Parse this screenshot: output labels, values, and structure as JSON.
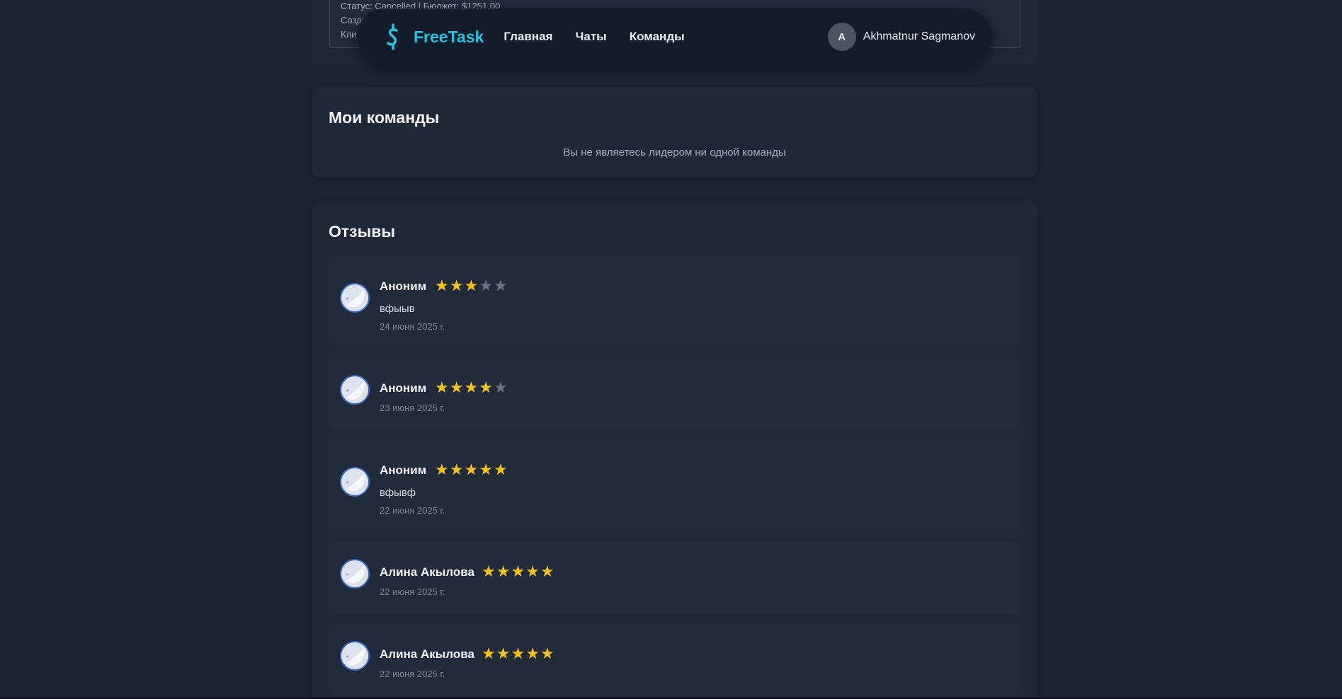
{
  "top_order": {
    "status_line": "Статус: Cancelled | Бюджет: $1251.00",
    "created_label": "Созда",
    "client_label": "Кли"
  },
  "navbar": {
    "logo_text": "FreeTask",
    "links": [
      "Главная",
      "Чаты",
      "Команды"
    ],
    "user_initial": "A",
    "user_name": "Akhmatnur Sagmanov"
  },
  "teams": {
    "title": "Мои команды",
    "empty_message": "Вы не являетесь лидером ни одной команды"
  },
  "reviews": {
    "title": "Отзывы",
    "items": [
      {
        "author": "Аноним",
        "rating": 3,
        "text": "вфыыв",
        "date": "24 июня 2025 г."
      },
      {
        "author": "Аноним",
        "rating": 4,
        "text": "",
        "date": "23 июня 2025 г."
      },
      {
        "author": "Аноним",
        "rating": 5,
        "text": "вфывф",
        "date": "22 июня 2025 г."
      },
      {
        "author": "Алина Акылова",
        "rating": 5,
        "text": "",
        "date": "22 июня 2025 г."
      },
      {
        "author": "Алина Акылова",
        "rating": 5,
        "text": "",
        "date": "22 июня 2025 г."
      }
    ]
  },
  "colors": {
    "background": "#1b2536",
    "card": "#1f2838",
    "accent": "#27c3e0",
    "star_on": "#f6c21b",
    "star_off": "#6b7383"
  }
}
